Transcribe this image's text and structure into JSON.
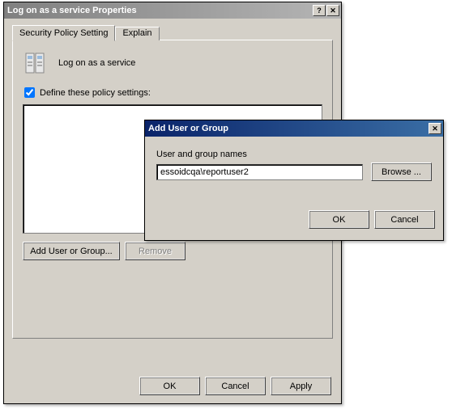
{
  "mainDialog": {
    "title": "Log on as a service Properties",
    "tabs": {
      "security": "Security Policy Setting",
      "explain": "Explain"
    },
    "policyName": "Log on as a service",
    "defineLabel": "Define these policy settings:",
    "defineChecked": true,
    "buttons": {
      "addUser": "Add User or Group...",
      "remove": "Remove",
      "ok": "OK",
      "cancel": "Cancel",
      "apply": "Apply"
    }
  },
  "addDialog": {
    "title": "Add User or Group",
    "fieldLabel": "User and group names",
    "value": "essoidcqa\\reportuser2",
    "browse": "Browse ...",
    "ok": "OK",
    "cancel": "Cancel"
  }
}
